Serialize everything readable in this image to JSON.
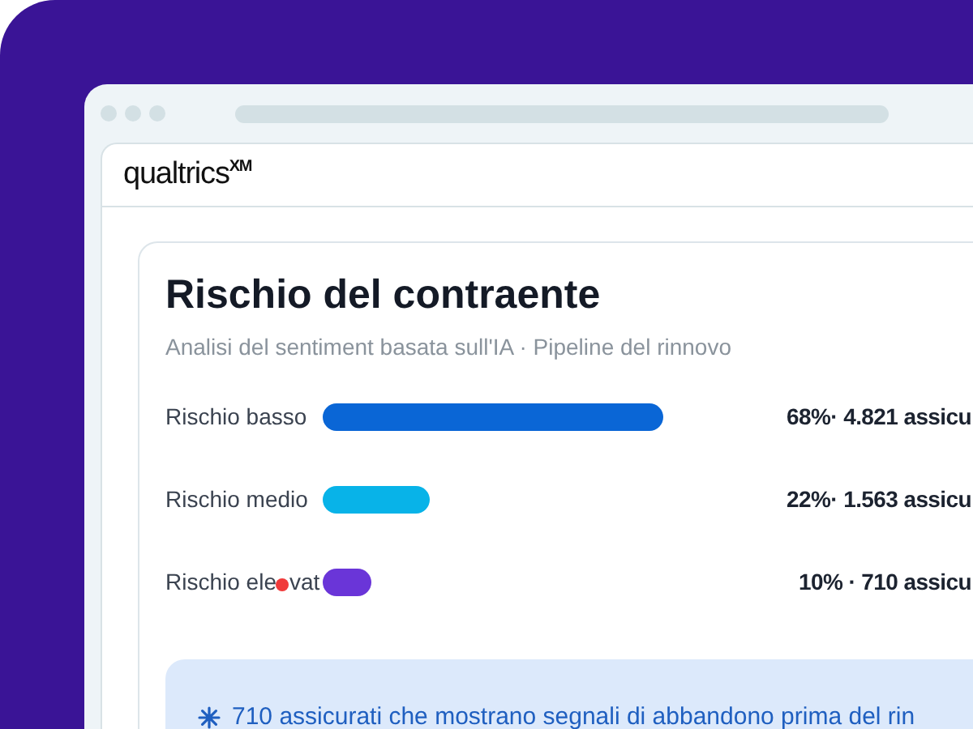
{
  "logo": "qualtrics$^{XM}$",
  "card": {
    "title": "Rischio del contraente",
    "subtitle": "Analisi del sentiment basata sull'IA · Pipeline del rinnovo",
    "risks": [
      {
        "label": "Rischio basso",
        "color": "#0a66d6",
        "value": "68%· 4.821 assicu"
      },
      {
        "label": "Rischio medio",
        "color": "#08b3e8",
        "value": "22%· 1.563 assicu"
      },
      {
        "label": "Rischio ele",
        "label_after_dot": "vat",
        "color": "#6a35d8",
        "value": "10% · 710 assicu"
      }
    ],
    "alert": "710 assicurati che mostrano segnali di abbandono prima del rin"
  }
}
